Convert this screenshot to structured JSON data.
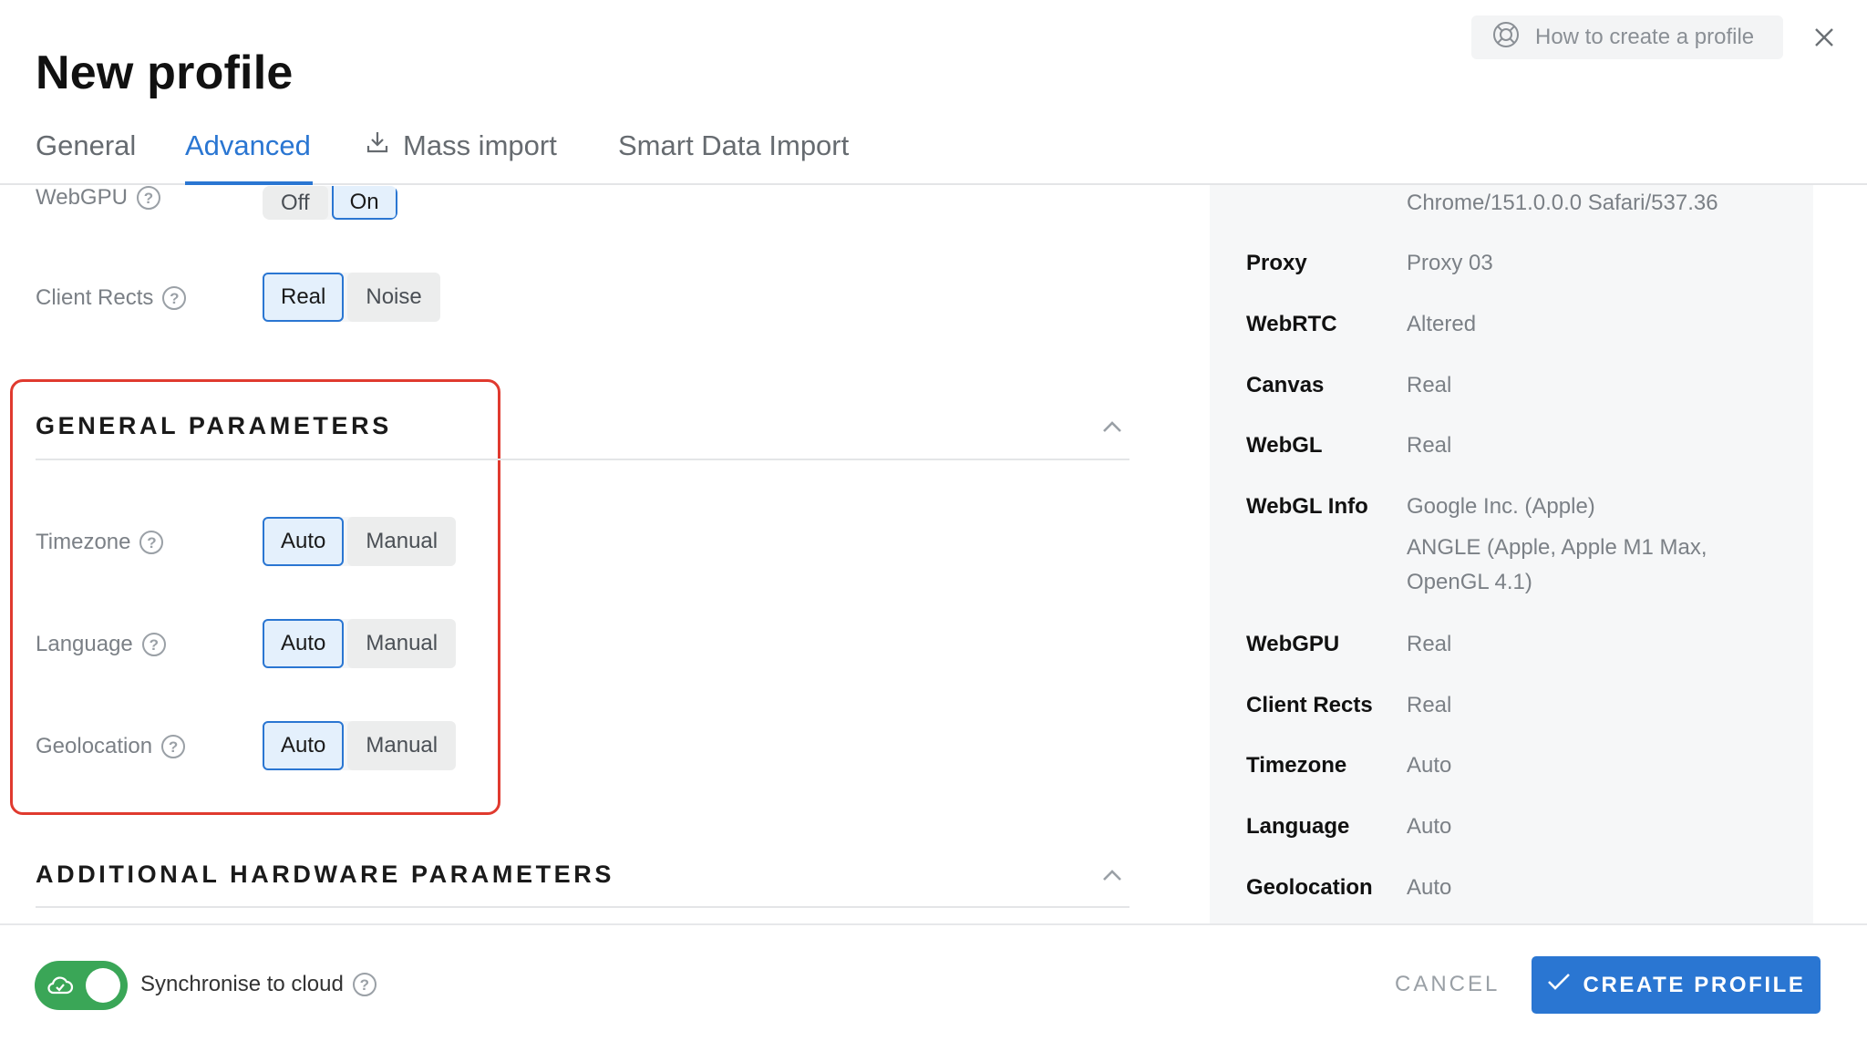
{
  "header": {
    "title": "New profile",
    "help_link": "How to create a profile"
  },
  "tabs": [
    {
      "label": "General"
    },
    {
      "label": "Advanced",
      "active": true
    },
    {
      "label": "Mass import"
    },
    {
      "label": "Smart Data Import"
    }
  ],
  "rows": {
    "webgpu": {
      "label": "WebGPU",
      "options": [
        "Off",
        "On"
      ],
      "selected": "On"
    },
    "client_rects": {
      "label": "Client Rects",
      "options": [
        "Real",
        "Noise"
      ],
      "selected": "Real"
    },
    "timezone": {
      "label": "Timezone",
      "options": [
        "Auto",
        "Manual"
      ],
      "selected": "Auto"
    },
    "language": {
      "label": "Language",
      "options": [
        "Auto",
        "Manual"
      ],
      "selected": "Auto"
    },
    "geolocation": {
      "label": "Geolocation",
      "options": [
        "Auto",
        "Manual"
      ],
      "selected": "Auto"
    }
  },
  "sections": {
    "general": "GENERAL PARAMETERS",
    "hardware": "ADDITIONAL HARDWARE PARAMETERS"
  },
  "summary": {
    "user_agent_tail": "Chrome/151.0.0.0 Safari/537.36",
    "items": [
      {
        "key": "Proxy",
        "value": "Proxy 03"
      },
      {
        "key": "WebRTC",
        "value": "Altered"
      },
      {
        "key": "Canvas",
        "value": "Real"
      },
      {
        "key": "WebGL",
        "value": "Real"
      },
      {
        "key": "WebGL Info",
        "value": "Google Inc. (Apple)",
        "value2": "ANGLE (Apple, Apple M1 Max,",
        "value3": "OpenGL 4.1)"
      },
      {
        "key": "WebGPU",
        "value": "Real"
      },
      {
        "key": "Client Rects",
        "value": "Real"
      },
      {
        "key": "Timezone",
        "value": "Auto"
      },
      {
        "key": "Language",
        "value": "Auto"
      },
      {
        "key": "Geolocation",
        "value": "Auto"
      }
    ]
  },
  "footer": {
    "sync_label": "Synchronise to cloud",
    "sync_on": true,
    "cancel": "CANCEL",
    "create": "CREATE PROFILE"
  },
  "colors": {
    "accent": "#2a76d2",
    "toggle_on": "#3aa657",
    "highlight_border": "#e03a2f"
  },
  "icons": {
    "help": "lifebuoy-icon",
    "close": "close-icon",
    "import": "download-icon",
    "question": "question-icon",
    "cloud": "cloud-check-icon",
    "check": "check-icon",
    "collapse": "chevron-up-icon"
  }
}
